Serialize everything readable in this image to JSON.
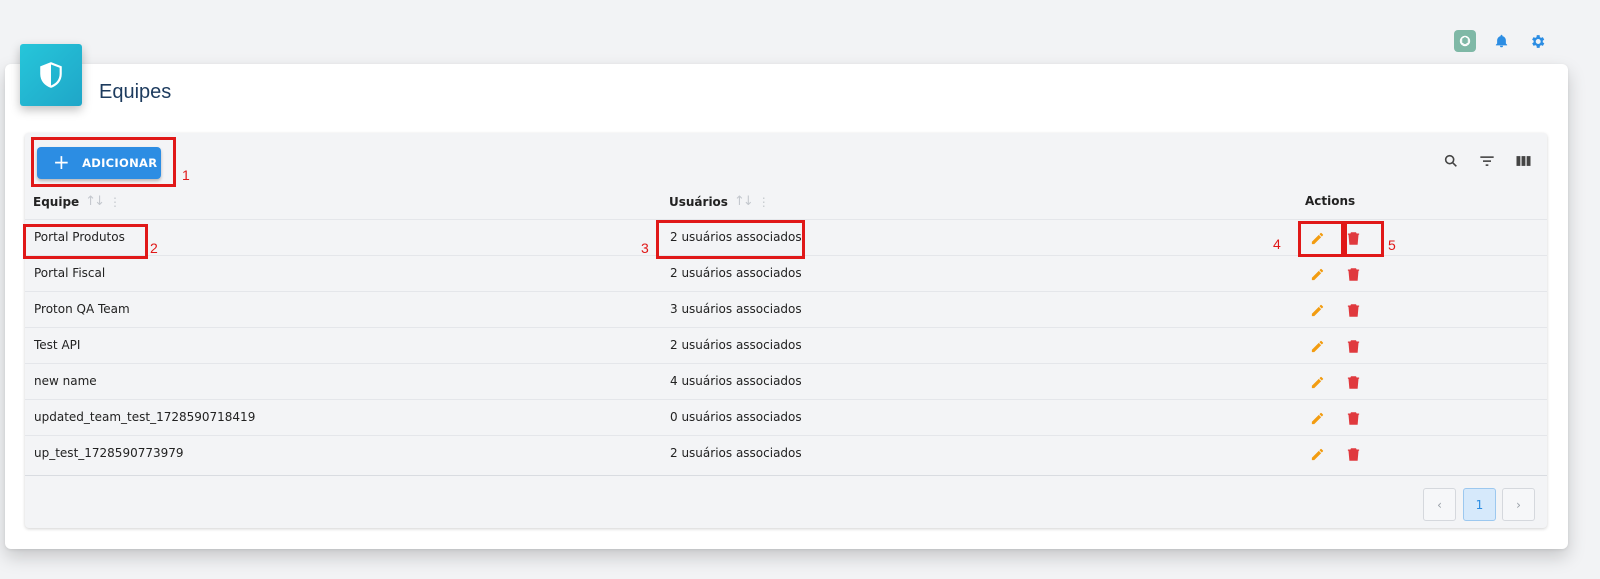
{
  "page": {
    "title": "Equipes"
  },
  "topbar": {
    "icons": [
      "chatgpt-icon",
      "bell-icon",
      "gear-icon"
    ]
  },
  "toolbar": {
    "add_label": "ADICIONAR",
    "add_icon": "plus-icon"
  },
  "tools": [
    "search-icon",
    "filter-icon",
    "columns-icon"
  ],
  "table": {
    "columns": [
      "Equipe",
      "Usuários",
      "Actions"
    ],
    "rows": [
      {
        "team": "Portal Produtos",
        "users": "2 usuários associados"
      },
      {
        "team": "Portal Fiscal",
        "users": "2 usuários associados"
      },
      {
        "team": "Proton QA Team",
        "users": "3 usuários associados"
      },
      {
        "team": "Test API",
        "users": "2 usuários associados"
      },
      {
        "team": "new name",
        "users": "4 usuários associados"
      },
      {
        "team": "updated_team_test_1728590718419",
        "users": "0 usuários associados"
      },
      {
        "team": "up_test_1728590773979",
        "users": "2 usuários associados"
      }
    ]
  },
  "pagination": {
    "prev": "‹",
    "current": "1",
    "next": "›"
  },
  "annotations": {
    "a1": "1",
    "a2": "2",
    "a3": "3",
    "a4": "4",
    "a5": "5"
  },
  "colors": {
    "accent": "#2c8de3",
    "edit": "#f29c11",
    "delete": "#e0393e",
    "header_icon": "#26c6da",
    "annotation": "#e01818"
  }
}
